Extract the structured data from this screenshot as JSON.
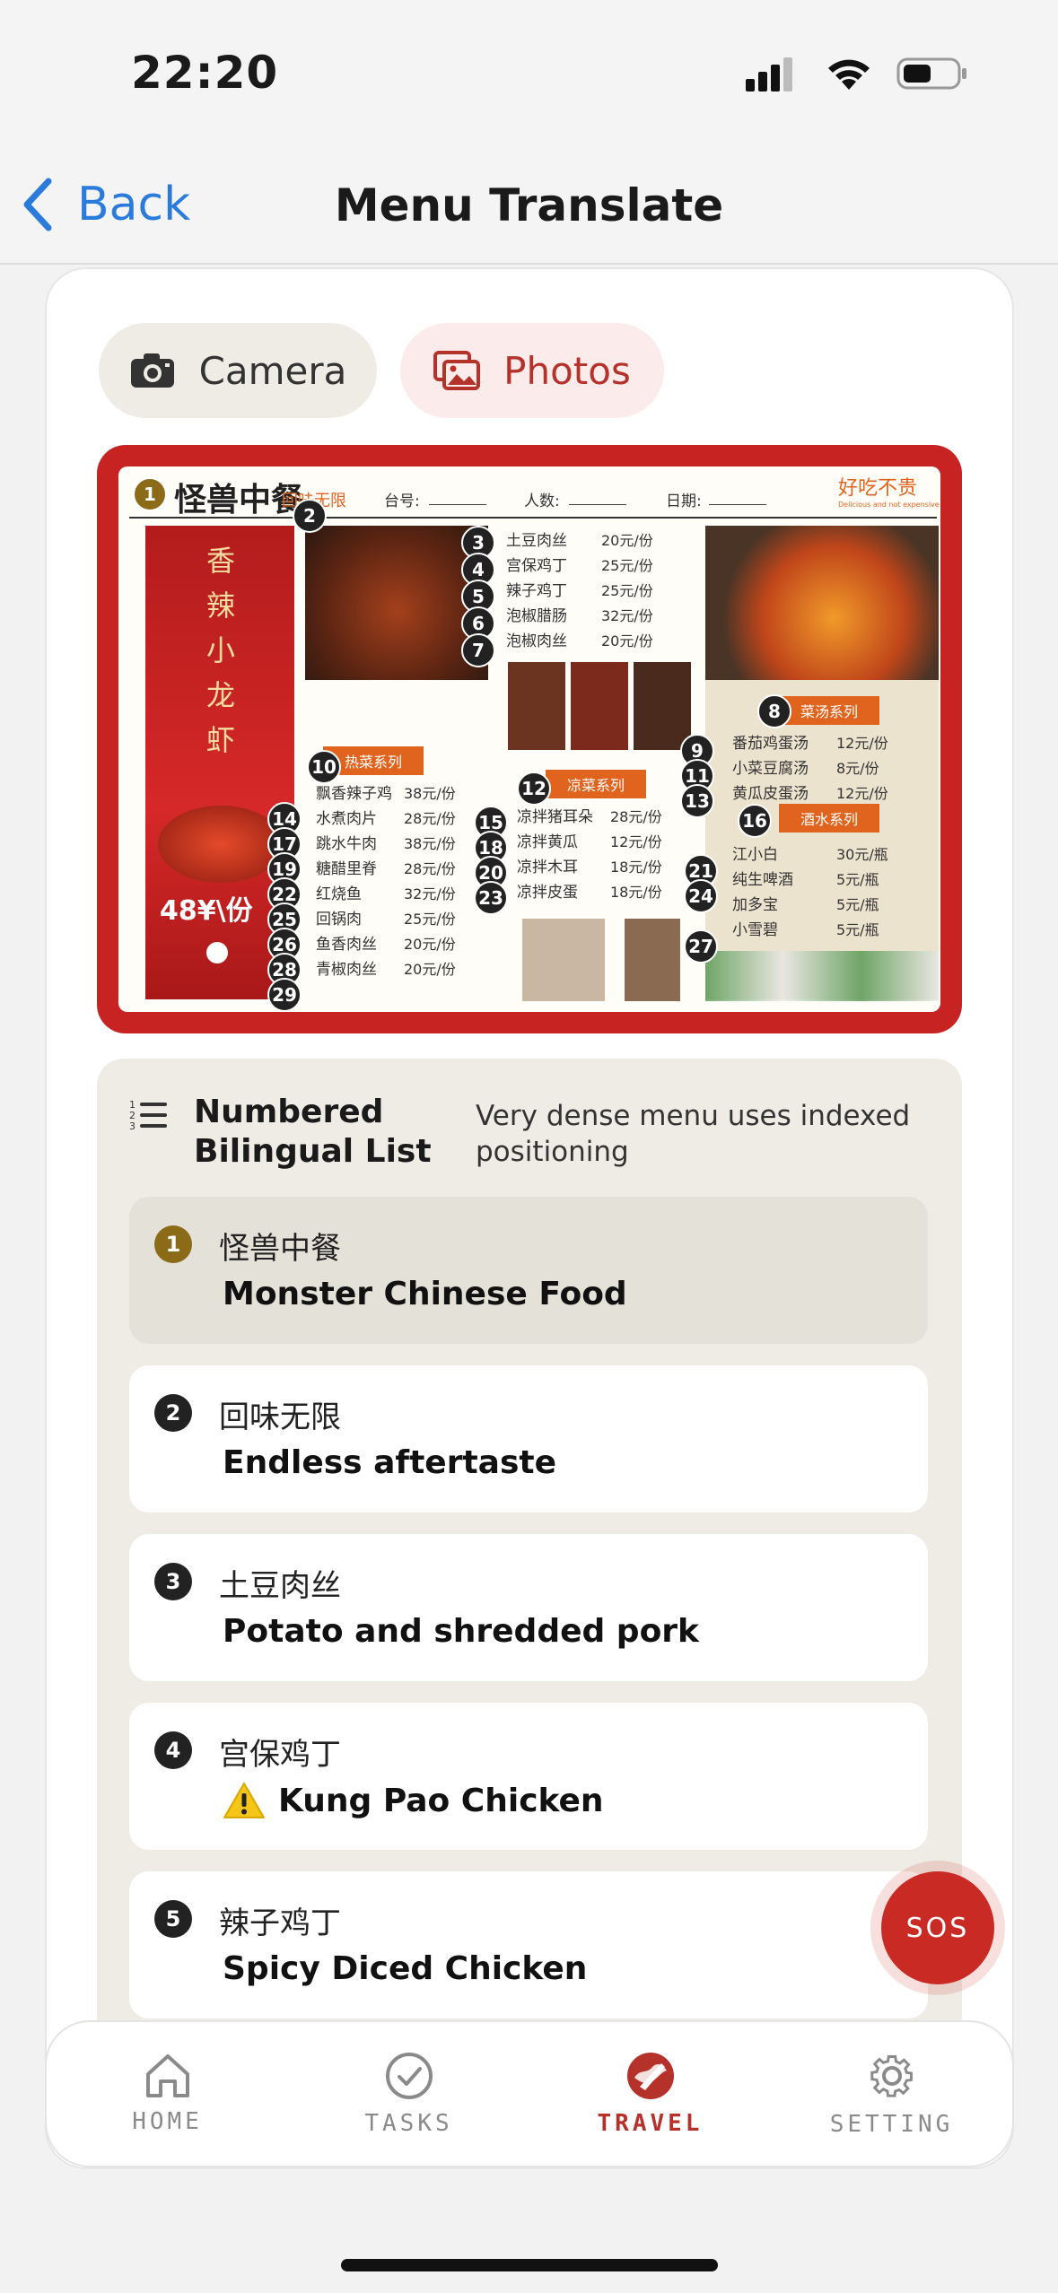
{
  "status_bar": {
    "time": "22:20"
  },
  "nav": {
    "back_label": "Back",
    "title": "Menu Translate"
  },
  "source_toggle": {
    "camera_label": "Camera",
    "photos_label": "Photos",
    "active": "photos"
  },
  "menu_image": {
    "restaurant_name": "怪兽中餐",
    "tagline": "回味无限",
    "table_label": "台号:",
    "people_label": "人数:",
    "date_label": "日期:",
    "slogan": "好吃不贵",
    "slogan_sub": "Delicious and not expensive",
    "crayfish_banner": "香辣小龙虾",
    "crayfish_price": "48¥\\份",
    "section_hot": "热菜系列",
    "section_cold": "凉菜系列",
    "section_soup": "菜汤系列",
    "section_drinks": "酒水系列",
    "top_items": [
      {
        "name": "土豆肉丝",
        "price": "20元/份"
      },
      {
        "name": "宫保鸡丁",
        "price": "25元/份"
      },
      {
        "name": "辣子鸡丁",
        "price": "25元/份"
      },
      {
        "name": "泡椒腊肠",
        "price": "32元/份"
      },
      {
        "name": "泡椒肉丝",
        "price": "20元/份"
      }
    ],
    "hot_items": [
      {
        "name": "飘香辣子鸡",
        "price": "38元/份"
      },
      {
        "name": "水煮肉片",
        "price": "28元/份"
      },
      {
        "name": "跳水牛肉",
        "price": "38元/份"
      },
      {
        "name": "糖醋里脊",
        "price": "28元/份"
      },
      {
        "name": "红烧鱼",
        "price": "32元/份"
      },
      {
        "name": "回锅肉",
        "price": "25元/份"
      },
      {
        "name": "鱼香肉丝",
        "price": "20元/份"
      },
      {
        "name": "青椒肉丝",
        "price": "20元/份"
      }
    ],
    "cold_items": [
      {
        "name": "凉拌猪耳朵",
        "price": "28元/份"
      },
      {
        "name": "凉拌黄瓜",
        "price": "12元/份"
      },
      {
        "name": "凉拌木耳",
        "price": "18元/份"
      },
      {
        "name": "凉拌皮蛋",
        "price": "18元/份"
      }
    ],
    "soup_items": [
      {
        "name": "番茄鸡蛋汤",
        "price": "12元/份"
      },
      {
        "name": "小菜豆腐汤",
        "price": "8元/份"
      },
      {
        "name": "黄瓜皮蛋汤",
        "price": "12元/份"
      }
    ],
    "drink_items": [
      {
        "name": "江小白",
        "price": "30元/瓶"
      },
      {
        "name": "纯生啤酒",
        "price": "5元/瓶"
      },
      {
        "name": "加多宝",
        "price": "5元/瓶"
      },
      {
        "name": "小雪碧",
        "price": "5元/瓶"
      }
    ]
  },
  "list": {
    "title_line1": "Numbered",
    "title_line2": "Bilingual List",
    "description": "Very dense menu uses indexed positioning",
    "items": [
      {
        "num": "1",
        "cn": "怪兽中餐",
        "en": "Monster Chinese Food",
        "warning": false,
        "selected": true
      },
      {
        "num": "2",
        "cn": "回味无限",
        "en": "Endless aftertaste",
        "warning": false,
        "selected": false
      },
      {
        "num": "3",
        "cn": "土豆肉丝",
        "en": "Potato and shredded pork",
        "warning": false,
        "selected": false
      },
      {
        "num": "4",
        "cn": "宫保鸡丁",
        "en": "Kung Pao Chicken",
        "warning": true,
        "selected": false
      },
      {
        "num": "5",
        "cn": "辣子鸡丁",
        "en": "Spicy Diced Chicken",
        "warning": false,
        "selected": false
      }
    ]
  },
  "sos": {
    "label": "SOS"
  },
  "tabs": [
    {
      "label": "HOME",
      "icon": "home-icon"
    },
    {
      "label": "TASKS",
      "icon": "check-circle-icon"
    },
    {
      "label": "TRAVEL",
      "icon": "globe-plane-icon",
      "active": true
    },
    {
      "label": "SETTING",
      "icon": "gear-icon"
    }
  ],
  "colors": {
    "accent": "#b5322b",
    "ios_blue": "#2a7bdc",
    "gold_marker": "#8b6a18",
    "list_bg": "#efece6"
  }
}
